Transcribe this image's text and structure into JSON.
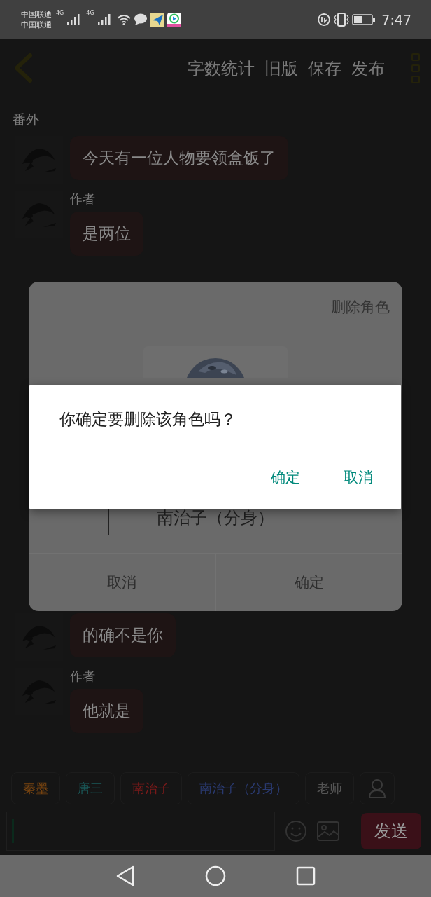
{
  "status_bar": {
    "carriers": [
      "中国联通",
      "中国联通"
    ],
    "network_labels": [
      "4G",
      "4G"
    ],
    "time": "7:47"
  },
  "header": {
    "actions": [
      "字数统计",
      "旧版",
      "保存",
      "发布"
    ]
  },
  "section_title": "番外",
  "messages": [
    {
      "text": "今天有一位人物要领盒饭了"
    },
    {
      "author": "作者",
      "text": "是两位"
    },
    {
      "text": "的确不是你"
    },
    {
      "author": "作者",
      "text": "他就是"
    }
  ],
  "character_chips": [
    {
      "label": "秦墨",
      "color": "#7a4510"
    },
    {
      "label": "唐三",
      "color": "#1a5a5a"
    },
    {
      "label": "南治子",
      "color": "#7a1a1a"
    },
    {
      "label": "南治子（分身）",
      "color": "#2a3a70"
    },
    {
      "label": "老师",
      "color": "#555555"
    }
  ],
  "composer": {
    "send_label": "发送"
  },
  "role_dialog": {
    "title": "删除角色",
    "name": "南治子（分身）",
    "buttons": [
      "取消",
      "确定"
    ]
  },
  "confirm_dialog": {
    "message": "你确定要删除该角色吗？",
    "buttons": [
      "确定",
      "取消"
    ]
  }
}
